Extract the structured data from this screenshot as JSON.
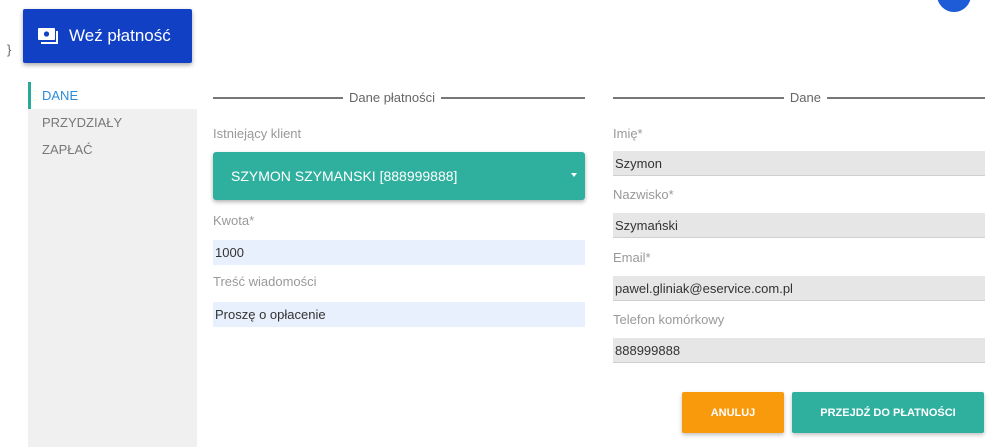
{
  "header": {
    "take_payment_label": "Weź płatność",
    "icon": "payment-card-icon",
    "stray_text": "}"
  },
  "sidebar": {
    "items": [
      {
        "label": "DANE",
        "active": true
      },
      {
        "label": "PRZYDZIAŁY",
        "active": false
      },
      {
        "label": "ZAPŁAĆ",
        "active": false
      }
    ]
  },
  "payment_section": {
    "legend": "Dane płatności",
    "existing_client_label": "Istniejący klient",
    "existing_client_value": "SZYMON SZYMANSKI [888999888]",
    "amount_label": "Kwota*",
    "amount_value": "1000",
    "message_label": "Treść wiadomości",
    "message_value": "Proszę o opłacenie"
  },
  "data_section": {
    "legend": "Dane",
    "first_name_label": "Imię*",
    "first_name_value": "Szymon",
    "last_name_label": "Nazwisko*",
    "last_name_value": "Szymański",
    "email_label": "Email*",
    "email_value": "pawel.gliniak@eservice.com.pl",
    "phone_label": "Telefon komórkowy",
    "phone_value": "888999888"
  },
  "actions": {
    "cancel_label": "ANULUJ",
    "proceed_label": "PRZEJDŹ DO PŁATNOŚCI"
  },
  "colors": {
    "primary_blue": "#1140c5",
    "teal": "#2fb09f",
    "orange": "#f99a0c",
    "active_tab_text": "#2b8bd8"
  }
}
